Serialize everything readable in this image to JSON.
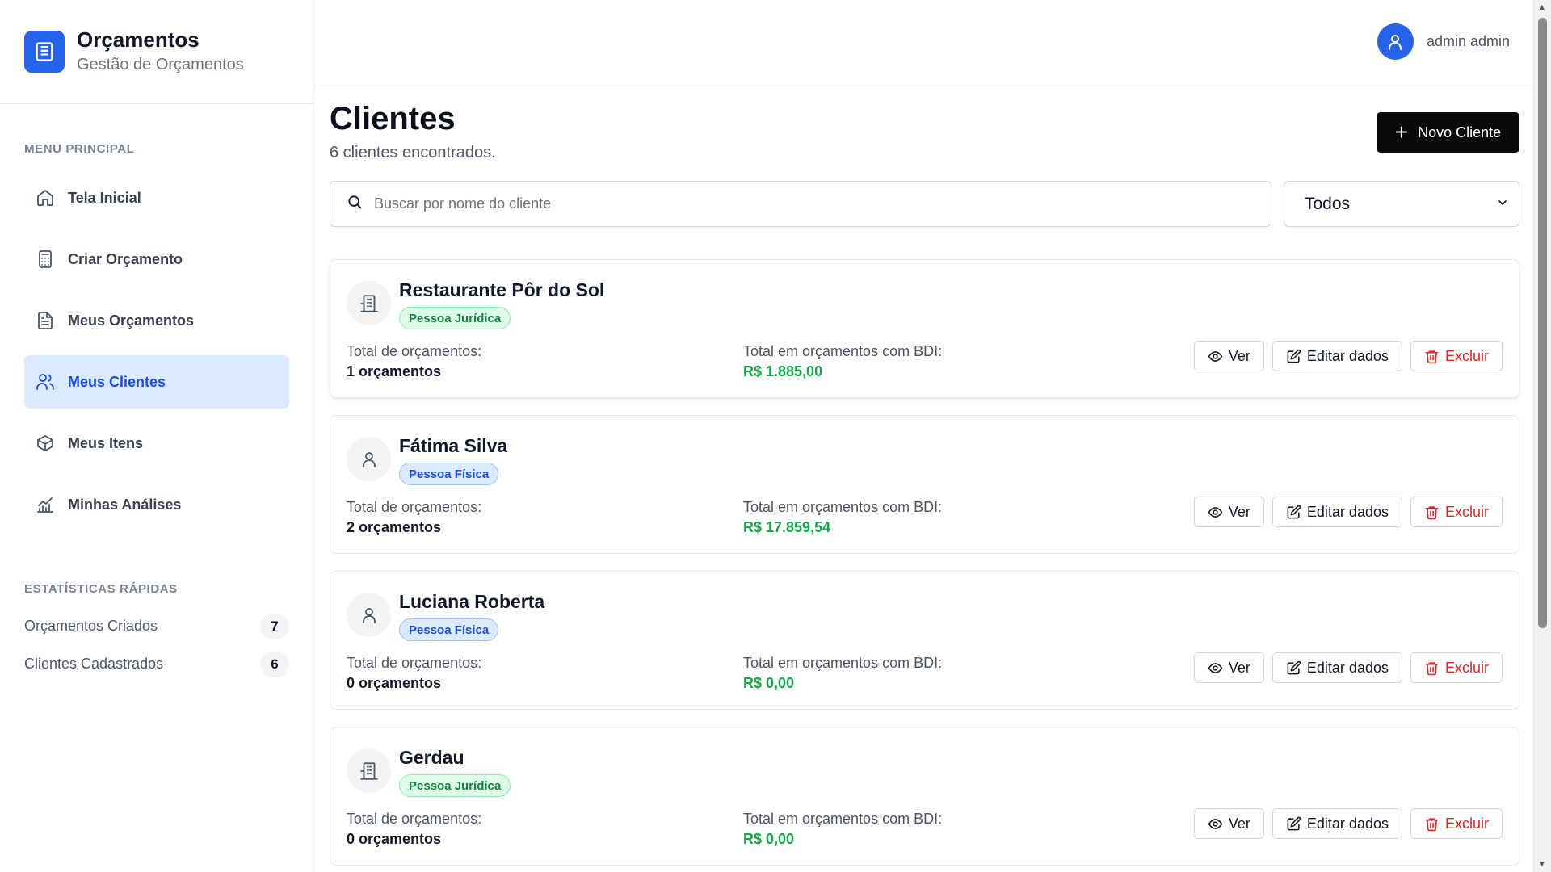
{
  "brand": {
    "title": "Orçamentos",
    "subtitle": "Gestão de Orçamentos"
  },
  "sidebar": {
    "menu_label": "MENU PRINCIPAL",
    "items": [
      {
        "label": "Tela Inicial",
        "icon": "home-icon",
        "active": false
      },
      {
        "label": "Criar Orçamento",
        "icon": "calculator-icon",
        "active": false
      },
      {
        "label": "Meus Orçamentos",
        "icon": "document-icon",
        "active": false
      },
      {
        "label": "Meus Clientes",
        "icon": "users-icon",
        "active": true
      },
      {
        "label": "Meus Itens",
        "icon": "box-icon",
        "active": false
      },
      {
        "label": "Minhas Análises",
        "icon": "chart-icon",
        "active": false
      }
    ],
    "stats_label": "ESTATÍSTICAS RÁPIDAS",
    "stats": [
      {
        "label": "Orçamentos Criados",
        "value": "7"
      },
      {
        "label": "Clientes Cadastrados",
        "value": "6"
      }
    ]
  },
  "header": {
    "user_name": "admin admin"
  },
  "main": {
    "title": "Clientes",
    "subtitle": "6 clientes encontrados.",
    "new_button": "Novo Cliente",
    "search_placeholder": "Buscar por nome do cliente",
    "filter_value": "Todos"
  },
  "clients": [
    {
      "name": "Restaurante Pôr do Sol",
      "type": "Pessoa Jurídica",
      "kind": "pj",
      "total_label": "Total de orçamentos:",
      "total": "1 orçamentos",
      "bdi_label": "Total em orçamentos com BDI:",
      "bdi": "R$ 1.885,00"
    },
    {
      "name": "Fátima Silva",
      "type": "Pessoa Física",
      "kind": "pf",
      "total_label": "Total de orçamentos:",
      "total": "2 orçamentos",
      "bdi_label": "Total em orçamentos com BDI:",
      "bdi": "R$ 17.859,54"
    },
    {
      "name": "Luciana Roberta",
      "type": "Pessoa Física",
      "kind": "pf",
      "total_label": "Total de orçamentos:",
      "total": "0 orçamentos",
      "bdi_label": "Total em orçamentos com BDI:",
      "bdi": "R$ 0,00"
    },
    {
      "name": "Gerdau",
      "type": "Pessoa Jurídica",
      "kind": "pj",
      "total_label": "Total de orçamentos:",
      "total": "0 orçamentos",
      "bdi_label": "Total em orçamentos com BDI:",
      "bdi": "R$ 0,00"
    }
  ],
  "actions": {
    "view": "Ver",
    "edit": "Editar dados",
    "delete": "Excluir"
  },
  "colors": {
    "primary": "#2563eb",
    "success": "#16a34a",
    "danger": "#dc2626",
    "active_bg": "#dbeafe"
  }
}
